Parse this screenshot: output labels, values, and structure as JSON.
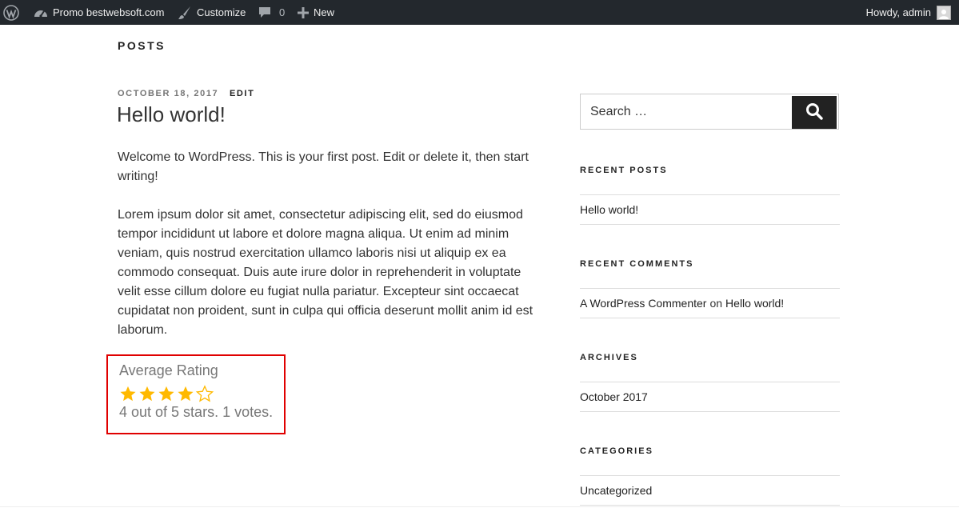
{
  "adminbar": {
    "site_name": "Promo bestwebsoft.com",
    "customize": "Customize",
    "comments_count": "0",
    "new": "New",
    "howdy": "Howdy, admin"
  },
  "page": {
    "title": "POSTS"
  },
  "post": {
    "date": "OCTOBER 18, 2017",
    "edit": "EDIT",
    "title": "Hello world!",
    "paragraphs": [
      "Welcome to WordPress. This is your first post. Edit or delete it, then start writing!",
      "Lorem ipsum dolor sit amet, consectetur adipiscing elit, sed do eiusmod tempor incididunt ut labore et dolore magna aliqua. Ut enim ad minim veniam, quis nostrud exercitation ullamco laboris nisi ut aliquip ex ea commodo consequat. Duis aute irure dolor in reprehenderit in voluptate velit esse cillum dolore eu fugiat nulla pariatur. Excepteur sint occaecat cupidatat non proident, sunt in culpa qui officia deserunt mollit anim id est laborum."
    ]
  },
  "rating": {
    "title": "Average Rating",
    "stars_filled": 4,
    "stars_total": 5,
    "summary": "4 out of 5 stars. 1 votes.",
    "highlight_color": "#e00000",
    "star_color": "#ffb900"
  },
  "sidebar": {
    "search_placeholder": "Search …",
    "recent_posts": {
      "title": "RECENT POSTS",
      "items": [
        "Hello world!"
      ]
    },
    "recent_comments": {
      "title": "RECENT COMMENTS",
      "author": "A WordPress Commenter",
      "on": "on",
      "post": "Hello world!"
    },
    "archives": {
      "title": "ARCHIVES",
      "items": [
        "October 2017"
      ]
    },
    "categories": {
      "title": "CATEGORIES",
      "items": [
        "Uncategorized"
      ]
    }
  },
  "icons": {
    "wp_logo": "wordpress-icon",
    "site": "dashboard-icon",
    "customize": "paintbrush-icon",
    "comments": "comment-bubble-icon",
    "new": "plus-icon",
    "avatar": "user-avatar",
    "search": "search-icon",
    "star_filled": "star-filled-icon",
    "star_empty": "star-empty-icon"
  }
}
